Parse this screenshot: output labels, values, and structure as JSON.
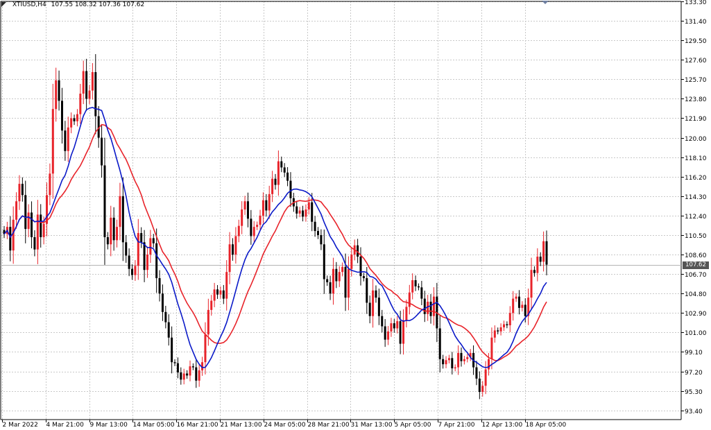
{
  "window": {
    "symbol_title": "XTIUSD,H4",
    "ohlc_text": "107.55 108.32 107.36 107.62"
  },
  "colors": {
    "background": "#ffffff",
    "grid": "#c8c8c8",
    "bull_candle": "#e8232a",
    "bear_candle": "#000000",
    "ma_fast": "#0a19c8",
    "ma_slow": "#e8232a",
    "current_line": "#b4b4b4",
    "price_tag": "#555555"
  },
  "icons": [
    "collapse-arrow-icon",
    "chart-shift-marker-icon"
  ],
  "chart_data": {
    "type": "candlestick",
    "symbol": "XTIUSD",
    "timeframe": "H4",
    "ylim": [
      92.5,
      133.3
    ],
    "current_price": 107.62,
    "y_ticks": [
      "133.30",
      "131.40",
      "129.50",
      "127.60",
      "125.70",
      "123.80",
      "121.90",
      "120.00",
      "118.10",
      "116.20",
      "114.30",
      "112.40",
      "110.50",
      "108.60",
      "106.70",
      "104.80",
      "102.90",
      "101.00",
      "99.10",
      "97.20",
      "95.30",
      "93.40"
    ],
    "x_ticks": [
      "2 Mar 2022",
      "4 Mar 21:00",
      "9 Mar 13:00",
      "14 Mar 05:00",
      "16 Mar 21:00",
      "21 Mar 13:00",
      "24 Mar 05:00",
      "28 Mar 21:00",
      "31 Mar 13:00",
      "5 Apr 05:00",
      "7 Apr 21:00",
      "12 Apr 13:00",
      "18 Apr 05:00"
    ],
    "closes": [
      110.6,
      111.3,
      109.0,
      112.0,
      113.8,
      115.5,
      114.4,
      111.1,
      112.7,
      110.3,
      109.1,
      112.5,
      110.3,
      111.6,
      114.4,
      116.5,
      122.8,
      125.6,
      123.6,
      120.7,
      118.7,
      121.0,
      121.9,
      121.6,
      122.3,
      124.3,
      126.5,
      123.8,
      124.6,
      126.4,
      122.1,
      120.0,
      117.3,
      110.3,
      109.6,
      112.2,
      110.0,
      111.3,
      114.3,
      109.8,
      108.5,
      107.2,
      106.6,
      107.5,
      110.7,
      109.8,
      107.1,
      108.6,
      110.2,
      109.7,
      106.3,
      104.8,
      103.0,
      102.0,
      100.5,
      98.1,
      98.0,
      97.1,
      96.4,
      97.0,
      96.8,
      97.7,
      97.6,
      96.3,
      97.3,
      98.1,
      100.8,
      103.2,
      104.1,
      105.2,
      104.7,
      105.1,
      104.3,
      106.9,
      109.6,
      108.6,
      110.4,
      111.4,
      113.0,
      113.8,
      112.1,
      110.4,
      111.3,
      111.5,
      112.4,
      113.9,
      112.9,
      114.5,
      116.0,
      115.4,
      117.7,
      117.1,
      116.6,
      115.8,
      114.1,
      113.3,
      112.6,
      112.9,
      112.3,
      113.0,
      113.7,
      111.8,
      110.9,
      110.5,
      109.6,
      106.2,
      105.9,
      104.8,
      107.2,
      106.0,
      106.9,
      107.4,
      104.4,
      107.2,
      108.6,
      109.5,
      108.4,
      106.5,
      106.3,
      103.9,
      102.6,
      105.1,
      104.4,
      102.6,
      101.6,
      100.3,
      101.1,
      101.9,
      101.4,
      102.1,
      99.9,
      102.2,
      103.5,
      104.9,
      106.1,
      105.5,
      105.4,
      104.3,
      102.8,
      104.0,
      102.6,
      104.5,
      101.4,
      98.4,
      97.9,
      98.3,
      98.5,
      97.5,
      97.6,
      99.0,
      98.2,
      98.4,
      98.6,
      99.0,
      97.6,
      96.5,
      95.2,
      95.8,
      97.4,
      98.4,
      100.5,
      101.2,
      101.1,
      101.5,
      101.8,
      101.7,
      102.9,
      104.3,
      104.5,
      103.4,
      103.7,
      102.6,
      104.4,
      107.1,
      106.8,
      108.4,
      107.9,
      109.9,
      107.62
    ],
    "ma_fast_name": "",
    "ma_slow_name": ""
  }
}
